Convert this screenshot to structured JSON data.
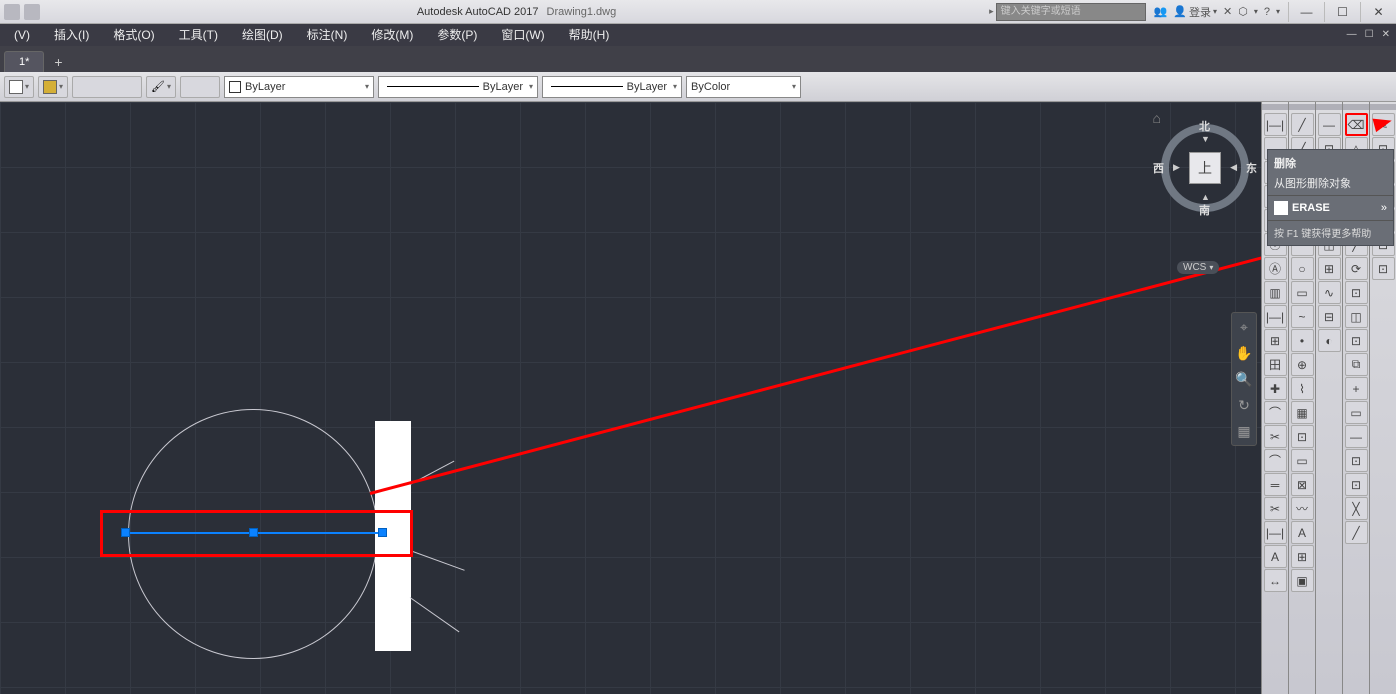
{
  "title": {
    "app": "Autodesk AutoCAD 2017",
    "doc": "Drawing1.dwg"
  },
  "search_placeholder": "键入关键字或短语",
  "login_label": "登录",
  "menus": [
    "(V)",
    "插入(I)",
    "格式(O)",
    "工具(T)",
    "绘图(D)",
    "标注(N)",
    "修改(M)",
    "参数(P)",
    "窗口(W)",
    "帮助(H)"
  ],
  "tab": {
    "name": "1*",
    "add": "+"
  },
  "toolbar": {
    "layer_label": "ByLayer",
    "linetype_label": "ByLayer",
    "lineweight_label": "ByLayer",
    "plotstyle_label": "ByColor"
  },
  "tooltip": {
    "title": "删除",
    "desc": "从图形删除对象",
    "cmd_label": "ERASE",
    "help_label": "按 F1 键获得更多帮助"
  },
  "viewcube": {
    "face": "上",
    "n": "北",
    "s": "南",
    "e": "东",
    "w": "西",
    "wcs": "WCS"
  },
  "win_controls": {
    "min": "—",
    "max": "☐",
    "close": "✕"
  },
  "nav_icons": [
    "⌖",
    "✋",
    "🔍",
    "↻",
    "▦"
  ],
  "tool_columns": [
    [
      "|—|",
      "↔",
      "⊟",
      "✎",
      "⊞",
      "⦿",
      "Ⓐ",
      "▥",
      "|—|",
      "⊞",
      "田",
      "✚",
      "⌒",
      "✂",
      "⌒",
      "═",
      "✂",
      "|—|",
      "A",
      "↔"
    ],
    [
      "╱",
      "╱",
      "⬠",
      "⊙",
      "~",
      "⌒",
      "○",
      "▭",
      "~",
      "•",
      "⊕",
      "⌇",
      "▦",
      "⊡",
      "▭",
      "⊠",
      "〰",
      "A",
      "⊞",
      "▣"
    ],
    [
      "—",
      "⊡",
      "⊙",
      "⤢",
      "△",
      "◫",
      "⊞",
      "∿",
      "⊟",
      "◐"
    ],
    [
      "⌫",
      "△",
      "⊞",
      "╋",
      "⟲",
      "╱",
      "⟳",
      "⊡",
      "◫",
      "⊡",
      "⧉",
      "+",
      "▭",
      "—",
      "⊡",
      "⊡",
      "╳",
      "╱"
    ],
    [
      "✎",
      "⊡",
      "⊡",
      "⊡",
      "⊡",
      "⊡",
      "⊡"
    ]
  ]
}
